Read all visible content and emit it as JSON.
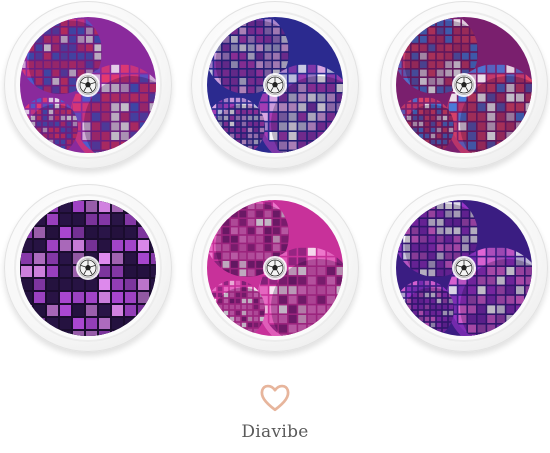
{
  "brand": {
    "name": "Diavibe",
    "heart_color": "#e7b59c"
  },
  "products": [
    {
      "theme": "disco-balls-pink-red",
      "colors": [
        "#8a2a9c",
        "#e83a6e",
        "#4a5fd0"
      ]
    },
    {
      "theme": "disco-balls-blue-purple",
      "colors": [
        "#2b2a8f",
        "#b13fb8",
        "#e3aee8"
      ]
    },
    {
      "theme": "disco-balls-red-magenta",
      "colors": [
        "#7a1f6e",
        "#e24468",
        "#4b7bd9"
      ]
    },
    {
      "theme": "mirror-tiles-violet",
      "colors": [
        "#2a1548",
        "#b04ad8",
        "#e18cf0"
      ]
    },
    {
      "theme": "disco-balls-hot-pink",
      "colors": [
        "#c8319a",
        "#f07ccf",
        "#7b1f74"
      ]
    },
    {
      "theme": "disco-ball-purple-bokeh",
      "colors": [
        "#3a1d82",
        "#9a34c8",
        "#e266d6"
      ]
    }
  ]
}
